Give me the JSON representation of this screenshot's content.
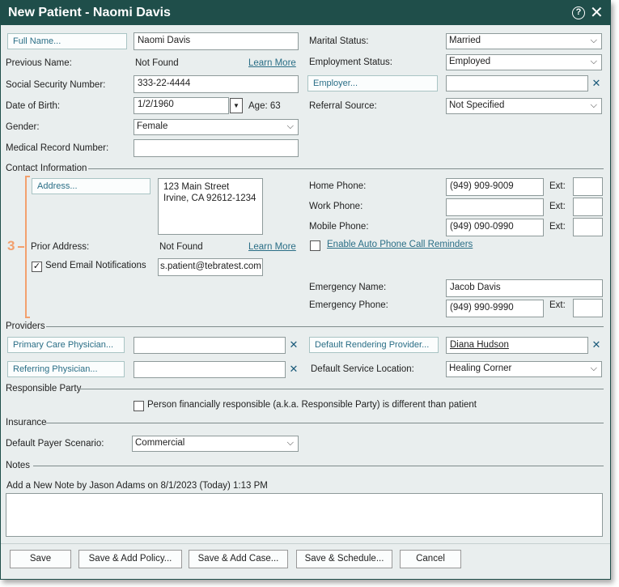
{
  "title": "New Patient - Naomi Davis",
  "left": {
    "full_name_btn": "Full Name...",
    "full_name_value": "Naomi Davis",
    "previous_name_label": "Previous Name:",
    "previous_name_value": "Not Found",
    "learn_more": "Learn More",
    "ssn_label": "Social Security Number:",
    "ssn_value": "333-22-4444",
    "dob_label": "Date of Birth:",
    "dob_value": "1/2/1960",
    "age": "Age: 63",
    "gender_label": "Gender:",
    "gender_value": "Female",
    "mrn_label": "Medical Record Number:",
    "mrn_value": ""
  },
  "right": {
    "marital_label": "Marital Status:",
    "marital_value": "Married",
    "employment_label": "Employment Status:",
    "employment_value": "Employed",
    "employer_btn": "Employer...",
    "employer_value": "",
    "referral_label": "Referral Source:",
    "referral_value": "Not Specified"
  },
  "contact": {
    "section": "Contact Information",
    "address_btn": "Address...",
    "address_line1": "123 Main Street",
    "address_line2": "Irvine, CA 92612-1234",
    "prior_address_label": "Prior Address:",
    "prior_address_value": "Not Found",
    "learn_more": "Learn More",
    "send_email_label": "Send Email Notifications",
    "email_value": "s.patient@tebratest.com",
    "callout": "3",
    "home_phone_label": "Home Phone:",
    "home_phone_value": "(949) 909-9009",
    "work_phone_label": "Work Phone:",
    "work_phone_value": "",
    "mobile_phone_label": "Mobile Phone:",
    "mobile_phone_value": "(949) 090-0990",
    "ext_label": "Ext:",
    "auto_reminders_label": "Enable Auto Phone Call Reminders",
    "emergency_name_label": "Emergency Name:",
    "emergency_name_value": "Jacob Davis",
    "emergency_phone_label": "Emergency Phone:",
    "emergency_phone_value": "(949) 990-9990"
  },
  "providers": {
    "section": "Providers",
    "pcp_btn": "Primary Care Physician...",
    "pcp_value": "",
    "referring_btn": "Referring Physician...",
    "referring_value": "",
    "rendering_btn": "Default Rendering Provider...",
    "rendering_value": "Diana Hudson",
    "service_location_label": "Default Service Location:",
    "service_location_value": "Healing Corner"
  },
  "responsible": {
    "section": "Responsible Party",
    "checkbox_label": "Person financially responsible (a.k.a. Responsible Party) is different than patient"
  },
  "insurance": {
    "section": "Insurance",
    "payer_label": "Default Payer Scenario:",
    "payer_value": "Commercial"
  },
  "notes": {
    "section": "Notes",
    "add_note_label": "Add a New Note by Jason Adams on 8/1/2023 (Today) 1:13 PM",
    "note_value": ""
  },
  "buttons": {
    "save": "Save",
    "save_add_policy": "Save & Add Policy...",
    "save_add_case": "Save & Add Case...",
    "save_schedule": "Save & Schedule...",
    "cancel": "Cancel"
  },
  "icons": {
    "help": "?",
    "close": "✕",
    "chevron": "⌵",
    "clear": "✕",
    "calendar_dropdown": "▼",
    "check": "✓"
  }
}
